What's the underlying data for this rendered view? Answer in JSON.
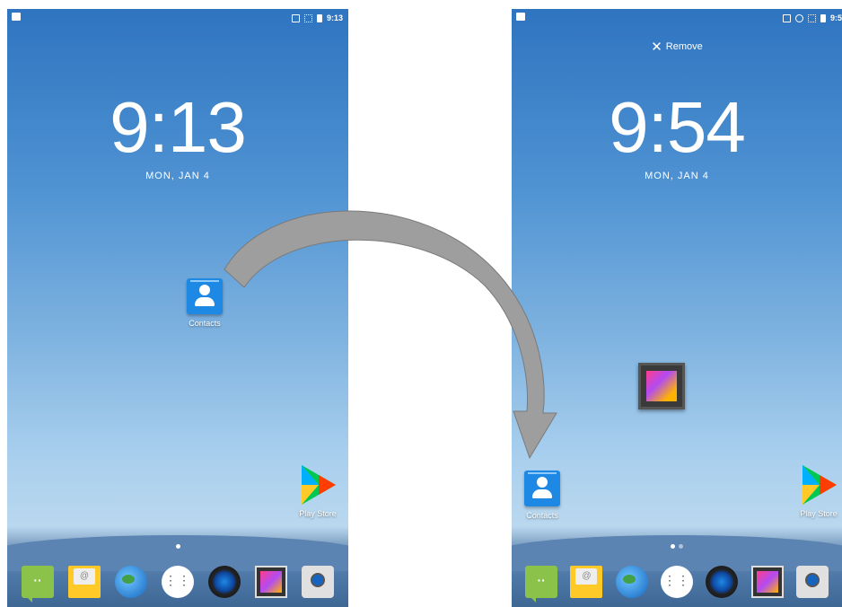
{
  "left_screen": {
    "status_time": "9:13",
    "clock": "9:13",
    "date": "MON, JAN 4",
    "contacts_label": "Contacts",
    "play_store_label": "Play Store"
  },
  "right_screen": {
    "status_time": "9:5",
    "remove_label": "Remove",
    "clock": "9:54",
    "date": "MON, JAN 4",
    "contacts_label": "Contacts",
    "play_store_label": "Play Store"
  },
  "dock": {
    "icons": [
      "messaging-icon",
      "email-icon",
      "browser-icon",
      "all-apps-icon",
      "music-icon",
      "gallery-icon",
      "camera-icon"
    ]
  },
  "colors": {
    "arrow": "#9e9e9e",
    "wallpaper_top": "#2f74c0",
    "contacts_blue": "#1e88e5"
  }
}
